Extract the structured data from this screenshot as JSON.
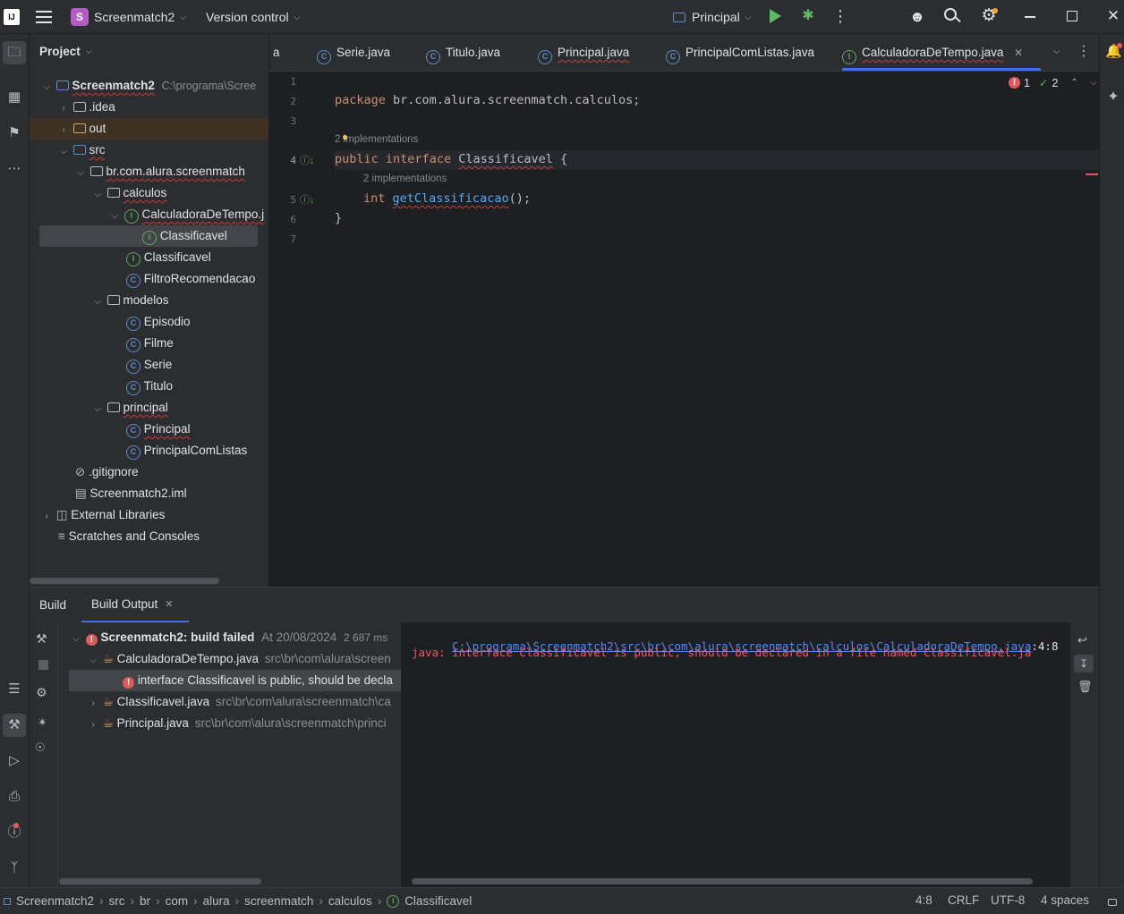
{
  "titlebar": {
    "app_logo": "IJ",
    "project_badge": "S",
    "project_name": "Screenmatch2",
    "vcs": "Version control",
    "run_config": "Principal"
  },
  "project_panel": {
    "title": "Project",
    "tree": [
      {
        "label": "Screenmatch2",
        "suffix": "C:\\programa\\Scree",
        "icon": "module-folder-icon"
      },
      {
        "label": ".idea",
        "icon": "folder-icon"
      },
      {
        "label": "out",
        "icon": "folder-icon"
      },
      {
        "label": "src",
        "icon": "source-folder-icon"
      },
      {
        "label": "br.com.alura.screenmatch",
        "icon": "package-icon"
      },
      {
        "label": "calculos",
        "icon": "package-icon"
      },
      {
        "label": "CalculadoraDeTempo.j",
        "icon": "interface-icon"
      },
      {
        "label": "Classificavel",
        "icon": "interface-icon"
      },
      {
        "label": "Classificavel",
        "icon": "interface-icon"
      },
      {
        "label": "FiltroRecomendacao",
        "icon": "class-icon"
      },
      {
        "label": "modelos",
        "icon": "package-icon"
      },
      {
        "label": "Episodio",
        "icon": "class-icon"
      },
      {
        "label": "Filme",
        "icon": "class-icon"
      },
      {
        "label": "Serie",
        "icon": "class-icon"
      },
      {
        "label": "Titulo",
        "icon": "class-icon"
      },
      {
        "label": "principal",
        "icon": "package-icon"
      },
      {
        "label": "Principal",
        "icon": "class-icon"
      },
      {
        "label": "PrincipalComListas",
        "icon": "class-icon"
      },
      {
        "label": ".gitignore",
        "icon": "ignore-file-icon"
      },
      {
        "label": "Screenmatch2.iml",
        "icon": "iml-file-icon"
      },
      {
        "label": "External Libraries",
        "icon": "libraries-icon"
      },
      {
        "label": "Scratches and Consoles",
        "icon": "scratches-icon"
      }
    ]
  },
  "editor_tabs": [
    {
      "label": "a"
    },
    {
      "label": "Serie.java"
    },
    {
      "label": "Titulo.java"
    },
    {
      "label": "Principal.java"
    },
    {
      "label": "PrincipalComListas.java"
    },
    {
      "label": "CalculadoraDeTempo.java",
      "active": true
    }
  ],
  "editor": {
    "error_count": "1",
    "warning_count": "2",
    "line_numbers": [
      "1",
      "2",
      "3",
      "4",
      "5",
      "6",
      "7"
    ],
    "package_kw": "package",
    "package_name": " br.com.alura.screenmatch.calculos;",
    "hint1": "2 implementations",
    "public_kw": "public",
    "interface_kw": "interface",
    "class_name": "Classificavel",
    "brace_open": " {",
    "hint2": "2 implementations",
    "int_kw": "int",
    "method_name": "getClassificacao",
    "method_tail": "();",
    "brace_close": "}"
  },
  "build": {
    "tab_build": "Build",
    "tab_output": "Build Output",
    "root_label": "Screenmatch2: build failed",
    "root_time": "At 20/08/2024",
    "root_ms": "2 687 ms",
    "file1": "CalculadoraDeTempo.java",
    "file1_path": "src\\br\\com\\alura\\screen",
    "error_item": "interface Classificavel is public, should be decla",
    "file2": "Classificavel.java",
    "file2_path": "src\\br\\com\\alura\\screenmatch\\ca",
    "file3": "Principal.java",
    "file3_path": "src\\br\\com\\alura\\screenmatch\\princi",
    "output_link": "C:\\programa\\Screenmatch2\\src\\br\\com\\alura\\screenmatch\\calculos\\CalculadoraDeTempo.java",
    "output_pos": ":4:8",
    "output_error": "java: interface Classificavel is public, should be declared in a file named Classificavel.ja"
  },
  "statusbar": {
    "breadcrumbs": [
      "Screenmatch2",
      "src",
      "br",
      "com",
      "alura",
      "screenmatch",
      "calculos",
      "Classificavel"
    ],
    "position": "4:8",
    "line_sep": "CRLF",
    "encoding": "UTF-8",
    "indent": "4 spaces"
  },
  "colors": {
    "accent": "#3574f0",
    "error": "#db5c5c",
    "keyword": "#cf8e6d",
    "function": "#56a8f5"
  }
}
